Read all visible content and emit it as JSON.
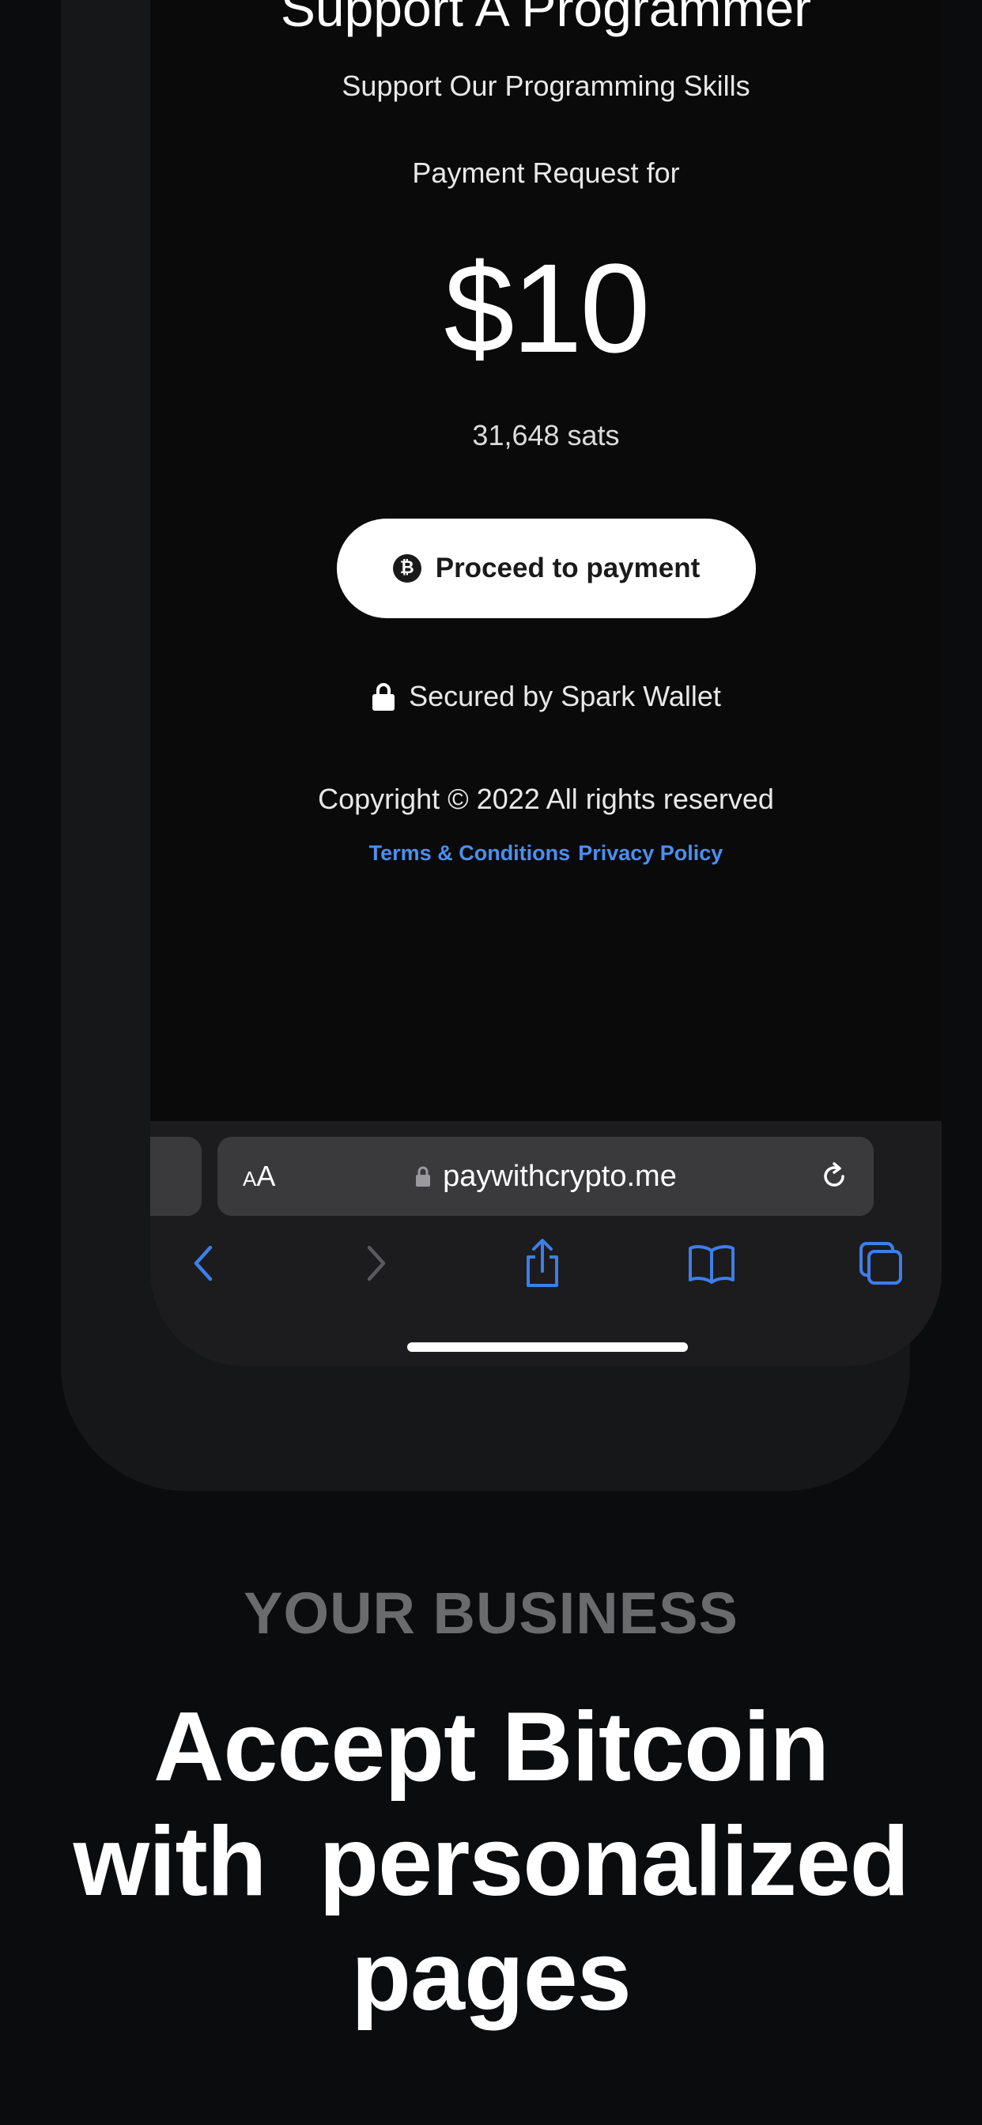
{
  "page": {
    "title": "Support A Programmer",
    "subtitle": "Support Our Programming Skills",
    "request_label": "Payment Request for",
    "amount": "$10",
    "sats": "31,648 sats",
    "pay_button_label": "Proceed to payment",
    "secured_label": "Secured by Spark Wallet",
    "copyright": "Copyright © 2022 All rights reserved",
    "links": {
      "terms": "Terms & Conditions",
      "privacy": "Privacy Policy"
    }
  },
  "browser": {
    "text_size_label_small": "A",
    "text_size_label_big": "A",
    "url": "paywithcrypto.me",
    "toolbar": [
      "back-icon",
      "forward-icon",
      "share-icon",
      "bookmarks-icon",
      "tabs-icon"
    ]
  },
  "marketing": {
    "eyebrow": "YOUR BUSINESS",
    "headline_lines": [
      "Accept Bitcoin",
      "with  personalized",
      "pages"
    ]
  },
  "colors": {
    "background": "#0b0c0e",
    "link": "#4b8ff0",
    "safari_bar": "#1c1c1e",
    "ios_blue": "#3e7ee8",
    "eyebrow": "#6a6b6d"
  },
  "icons": {
    "pay_button": "bitcoin-icon",
    "secured": "lock-icon",
    "url": "lock-icon",
    "reload": "reload-icon"
  }
}
